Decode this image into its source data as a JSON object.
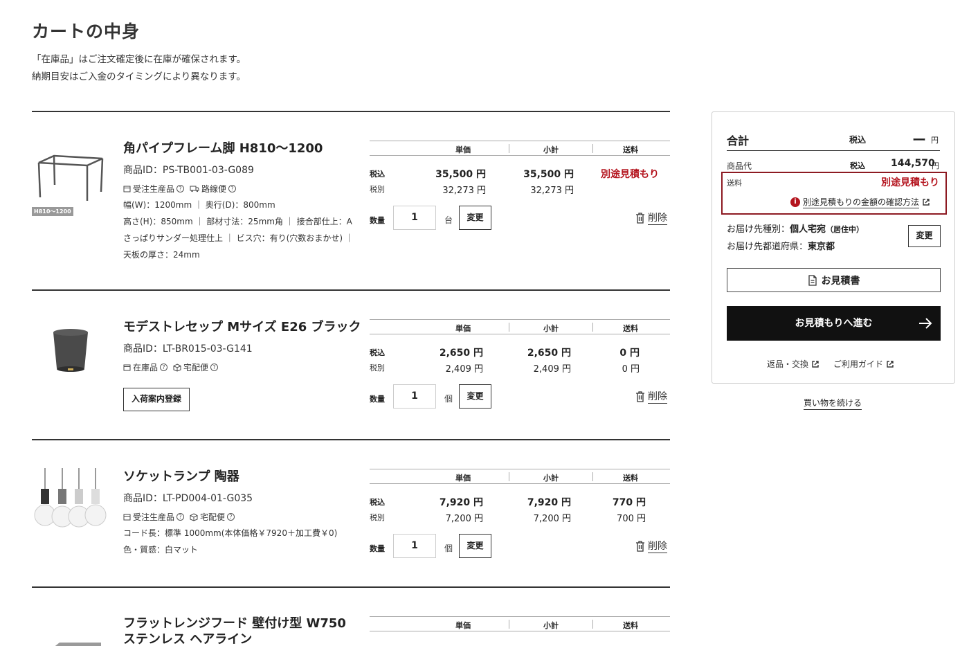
{
  "page": {
    "title": "カートの中身",
    "intro_1": "「在庫品」はご注文確定後に在庫が確保されます。",
    "intro_2": "納期目安はご入金のタイミングにより異なります。"
  },
  "table_headers": {
    "unit": "単価",
    "subtotal": "小計",
    "shipping": "送料"
  },
  "row_labels": {
    "tax_in": "税込",
    "tax_ex": "税別",
    "qty": "数量",
    "change": "変更",
    "delete": "削除"
  },
  "items": [
    {
      "name": "角パイプフレーム脚 H810〜1200",
      "id": "商品ID：PS-TB001-03-G089",
      "thumb_badge": "H810〜1200",
      "tag1": "受注生産品",
      "tag2": "路線便",
      "specs_1": "幅(W)：1200mm ｜ 奥行(D)：800mm",
      "specs_2": "高さ(H)：850mm ｜ 部材寸法：25mm角 ｜ 接合部仕上：Aさっぱりサンダー処理仕上 ｜ ビス穴：有り(穴数おまかせ) ｜",
      "specs_3": "天板の厚さ：24mm",
      "unit_in": "35,500 円",
      "unit_ex": "32,273 円",
      "sub_in": "35,500 円",
      "sub_ex": "32,273 円",
      "ship_in": "別途見積もり",
      "ship_ex": "",
      "qty": "1",
      "unit": "台"
    },
    {
      "name": "モデストレセップ Mサイズ E26 ブラック",
      "id": "商品ID：LT-BR015-03-G141",
      "tag1": "在庫品",
      "tag2": "宅配便",
      "notify_button": "入荷案内登録",
      "unit_in": "2,650 円",
      "unit_ex": "2,409 円",
      "sub_in": "2,650 円",
      "sub_ex": "2,409 円",
      "ship_in": "0 円",
      "ship_ex": "0 円",
      "qty": "1",
      "unit": "個"
    },
    {
      "name": "ソケットランプ 陶器",
      "id": "商品ID：LT-PD004-01-G035",
      "tag1": "受注生産品",
      "tag2": "宅配便",
      "specs_1": "コード長：標準 1000mm(本体価格￥7920＋加工費￥0)",
      "specs_2": "色・質感：白マット",
      "unit_in": "7,920 円",
      "unit_ex": "7,200 円",
      "sub_in": "7,920 円",
      "sub_ex": "7,200 円",
      "ship_in": "770 円",
      "ship_ex": "700 円",
      "qty": "1",
      "unit": "個"
    },
    {
      "name_1": "フラットレンジフード 壁付け型 W750",
      "name_2": "ステンレス ヘアライン"
    }
  ],
  "summary": {
    "total_label": "合計",
    "tax_label": "税込",
    "total_value": "ー",
    "yen": "円",
    "goods_label": "商品代",
    "goods_tax": "税込",
    "goods_value": "144,570",
    "ship_label": "送料",
    "ship_value": "別途見積もり",
    "ship_link": "別途見積もりの金額の確認方法",
    "dest_type_label": "お届け先種別：",
    "dest_type_value": "個人宅宛",
    "dest_type_note": "（居住中）",
    "dest_pref_label": "お届け先都道府県：",
    "dest_pref_value": "東京都",
    "change": "変更",
    "estimate": "お見積書",
    "proceed": "お見積もりへ進む",
    "returns": "返品・交換",
    "guide": "ご利用ガイド",
    "continue": "買い物を続ける"
  },
  "colors": {
    "accent_red": "#b4141e",
    "highlight_border": "#8d1a22",
    "primary_button": "#111111"
  }
}
